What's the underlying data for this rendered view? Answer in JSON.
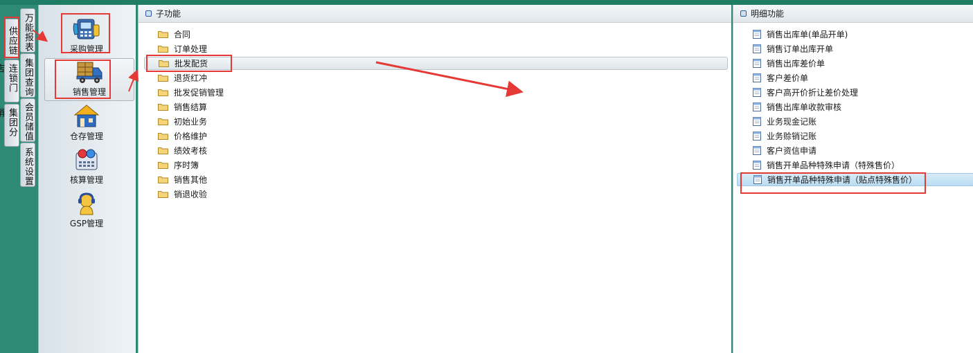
{
  "vtabs": {
    "supply_chain": "供应链",
    "chain_store": "连锁门店",
    "group_distribution": "集团分销",
    "universal_report": "万能报表",
    "group_query": "集团查询",
    "member_value": "会员储值",
    "system_settings": "系统设置"
  },
  "modules": [
    {
      "label": "采购管理",
      "icon": "purchase-icon"
    },
    {
      "label": "销售管理",
      "icon": "sales-truck-icon"
    },
    {
      "label": "仓存管理",
      "icon": "warehouse-icon"
    },
    {
      "label": "核算管理",
      "icon": "accounting-icon"
    },
    {
      "label": "GSP管理",
      "icon": "gsp-icon"
    }
  ],
  "sub_panel": {
    "title": "子功能",
    "items": [
      "合同",
      "订单处理",
      "批发配货",
      "退货红冲",
      "批发促销管理",
      "销售结算",
      "初始业务",
      "价格维护",
      "绩效考核",
      "序时簿",
      "销售其他",
      "销退收验"
    ],
    "selected_index": 2
  },
  "detail_panel": {
    "title": "明细功能",
    "items": [
      "销售出库单(单品开单)",
      "销售订单出库开单",
      "销售出库差价单",
      "客户差价单",
      "客户高开价折让差价处理",
      "销售出库单收款审核",
      "业务现金记账",
      "业务赊销记账",
      "客户资信申请",
      "销售开单品种特殊申请（特殊售价）",
      "销售开单品种特殊申请（贴点特殊售价）"
    ],
    "selected_index": 10
  },
  "colors": {
    "background": "#2e8a74",
    "annotation": "#e53935",
    "selection": "#b9dcf2"
  }
}
